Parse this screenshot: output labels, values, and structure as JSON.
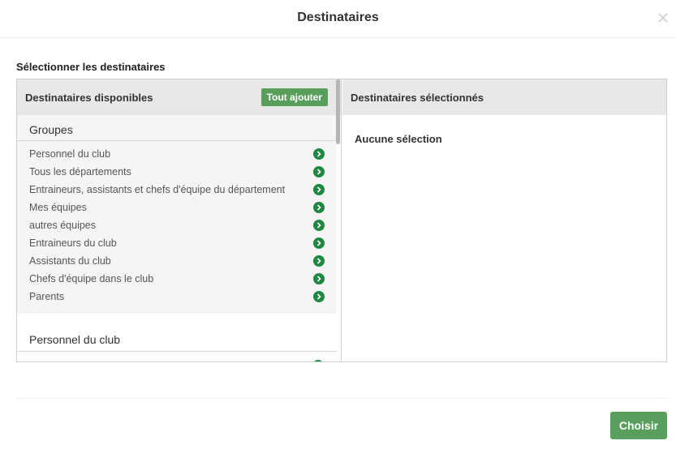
{
  "modal": {
    "title": "Destinataires",
    "close_icon": "close-icon"
  },
  "section_label": "Sélectionner les destinataires",
  "available": {
    "title": "Destinataires disponibles",
    "add_all_label": "Tout ajouter",
    "groups_title": "Groupes",
    "groups": [
      "Personnel du club",
      "Tous les départements",
      "Entraineurs, assistants et chefs d'équipe du département",
      "Mes équipes",
      "autres équipes",
      "Entraineurs du club",
      "Assistants du club",
      "Chefs d'équipe dans le club",
      "Parents"
    ],
    "second_section_title": "Personnel du club",
    "item_icon": "chevron-right-circle-icon"
  },
  "selected": {
    "title": "Destinataires sélectionnés",
    "empty_text": "Aucune sélection"
  },
  "footer": {
    "choose_label": "Choisir"
  },
  "colors": {
    "accent_button": "#5a9e5e",
    "arrow_icon": "#1d8a3f",
    "panel_header": "#e8e8e8",
    "group_bg": "#f5f5f5"
  }
}
